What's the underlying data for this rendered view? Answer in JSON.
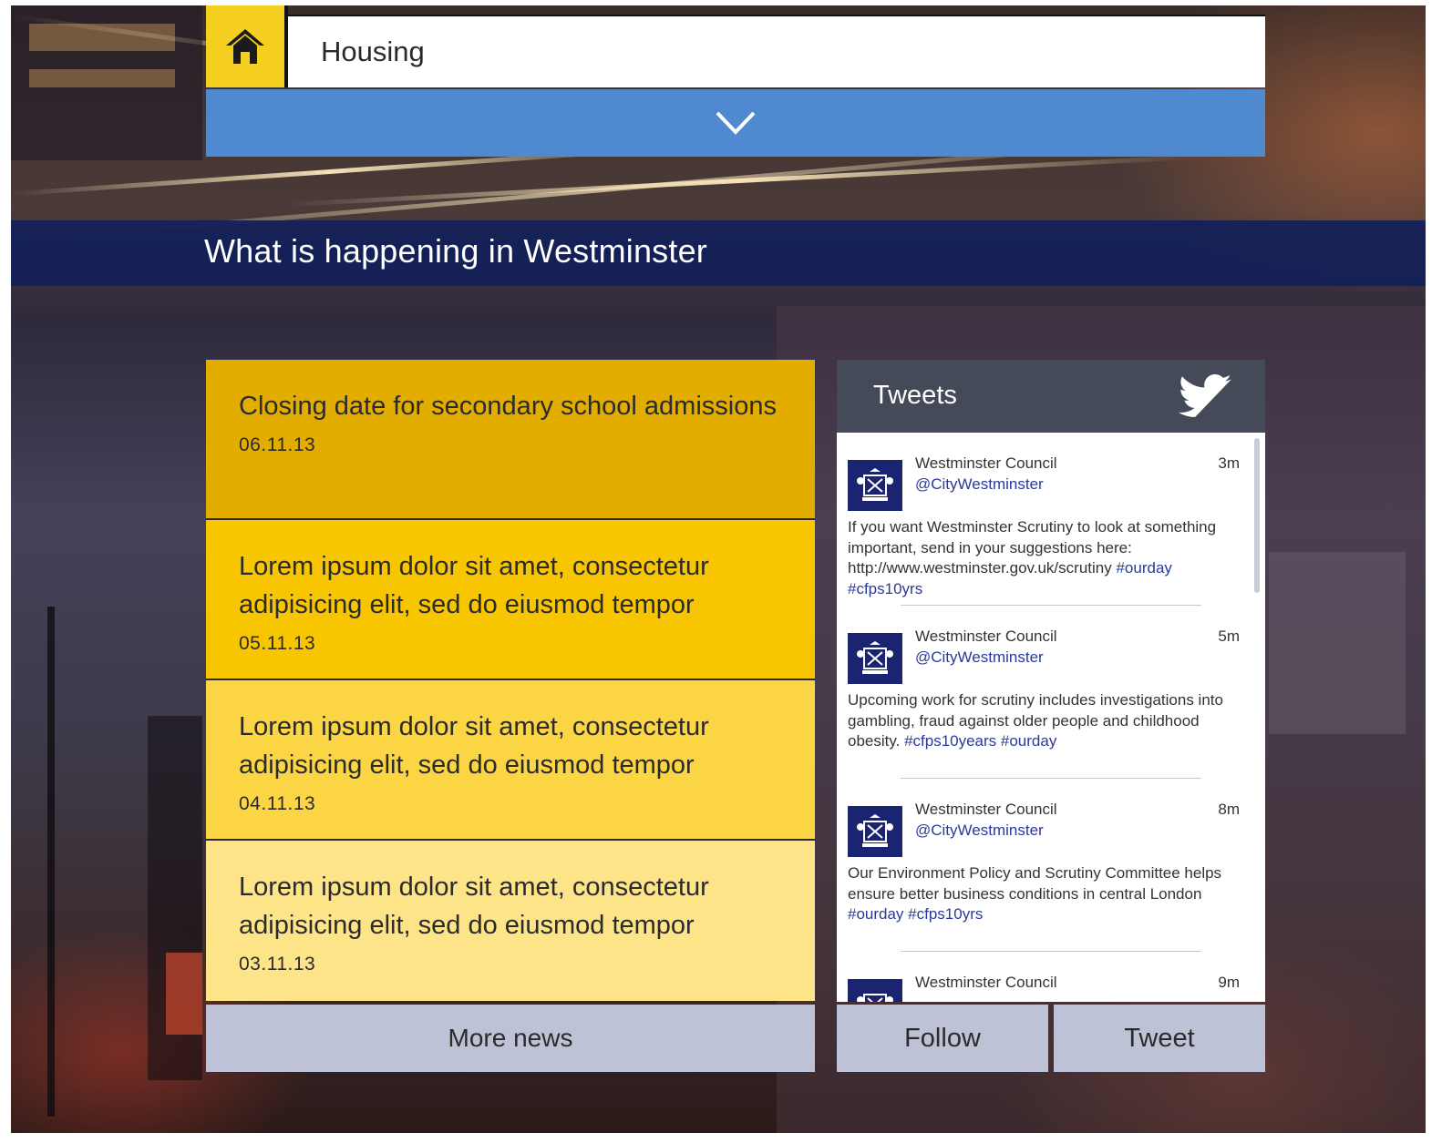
{
  "header": {
    "home_icon": "home-icon",
    "category_value": "Housing",
    "dropdown_icon": "chevron-down-icon"
  },
  "banner": {
    "title": "What is happening in Westminster"
  },
  "news": {
    "items": [
      {
        "title": "Closing date for secondary school admissions",
        "date": "06.11.13",
        "color": "#e3ad00"
      },
      {
        "title": "Lorem ipsum dolor sit amet, consectetur adipisicing elit, sed do eiusmod tempor",
        "date": "05.11.13",
        "color": "#f8c600"
      },
      {
        "title": "Lorem ipsum dolor sit amet, consectetur adipisicing elit, sed do eiusmod tempor",
        "date": "04.11.13",
        "color": "#fbd544"
      },
      {
        "title": "Lorem ipsum dolor sit amet, consectetur adipisicing elit, sed do eiusmod tempor",
        "date": "03.11.13",
        "color": "#fde489"
      }
    ],
    "more_label": "More news"
  },
  "tweets": {
    "header": "Tweets",
    "header_icon": "twitter-bird-icon",
    "items": [
      {
        "name": "Westminster Council",
        "handle": "@CityWestminster",
        "time": "3m",
        "text": "If you want Westminster Scrutiny to look at something important, send in your suggestions here: http://www.westminster.gov.uk/scrutiny",
        "tags": "#ourday #cfps10yrs"
      },
      {
        "name": "Westminster Council",
        "handle": "@CityWestminster",
        "time": "5m",
        "text": "Upcoming work for scrutiny includes investigations into gambling, fraud against older people and childhood obesity.",
        "tags": "#cfps10years #ourday"
      },
      {
        "name": "Westminster Council",
        "handle": "@CityWestminster",
        "time": "8m",
        "text": "Our Environment Policy and Scrutiny Committee helps ensure better business conditions in central London",
        "tags": "#ourday #cfps10yrs"
      },
      {
        "name": "Westminster Council",
        "handle": "",
        "time": "9m",
        "text": "",
        "tags": ""
      }
    ],
    "follow_label": "Follow",
    "tweet_label": "Tweet"
  }
}
